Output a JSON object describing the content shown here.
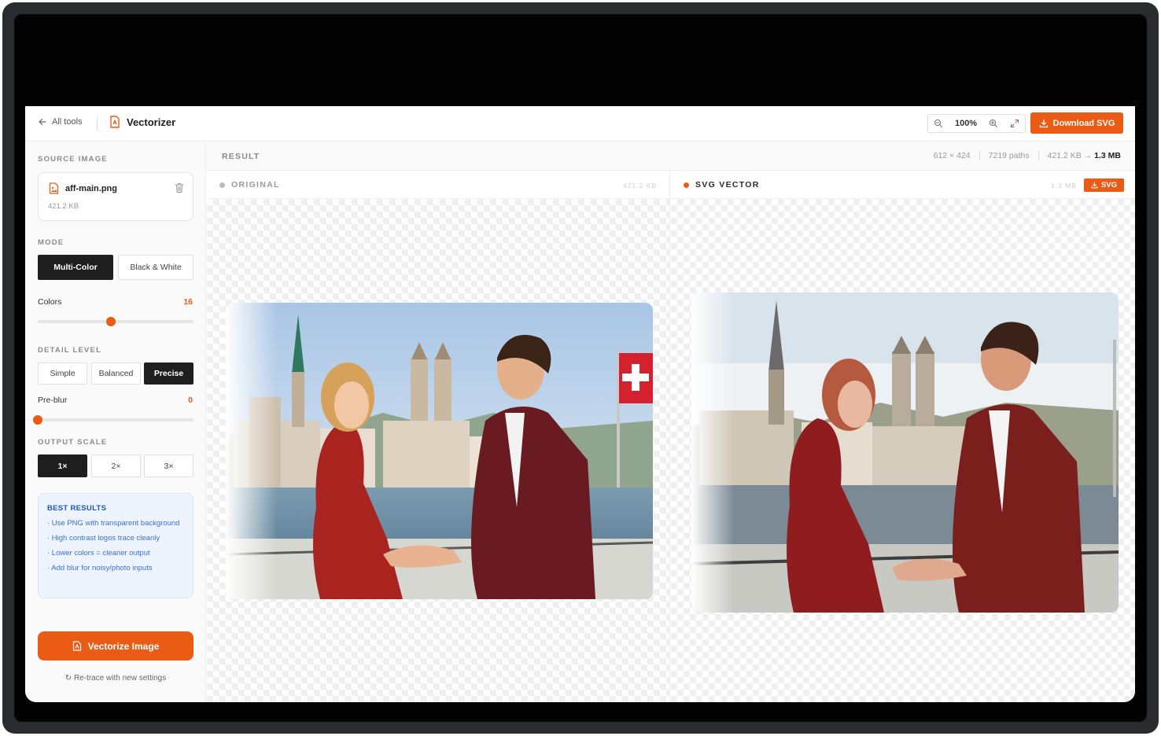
{
  "topbar": {
    "back_label": "All tools",
    "app_title": "Vectorizer",
    "zoom_level": "100%",
    "download_label": "Download SVG"
  },
  "sidebar": {
    "source_label": "SOURCE IMAGE",
    "file": {
      "name": "aff-main.png",
      "size": "421.2 KB"
    },
    "mode_label": "MODE",
    "modes": [
      "Multi-Color",
      "Black & White"
    ],
    "colors": {
      "label": "Colors",
      "value": "16",
      "fraction": 0.47
    },
    "detail_label": "DETAIL LEVEL",
    "details": [
      "Simple",
      "Balanced",
      "Precise"
    ],
    "preblur": {
      "label": "Pre-blur",
      "value": "0",
      "fraction": 0.0
    },
    "scale_label": "OUTPUT SCALE",
    "scales": [
      "1×",
      "2×",
      "3×"
    ],
    "tips": {
      "title": "BEST RESULTS",
      "items": [
        "· Use PNG with transparent background",
        "· High contrast logos trace cleanly",
        "· Lower colors = cleaner output",
        "· Add blur for noisy/photo inputs"
      ]
    },
    "vectorize_label": "Vectorize Image",
    "retrace_label": "Re-trace with new settings"
  },
  "main": {
    "result_label": "RESULT",
    "stats": {
      "dimensions": "612 × 424",
      "paths": "7219 paths",
      "size_before": "421.2 KB",
      "arrow": "→",
      "size_after": "1.3 MB"
    },
    "original": {
      "title": "ORIGINAL",
      "size": "421.2 KB"
    },
    "vector": {
      "title": "SVG VECTOR",
      "size": "1.3 MB",
      "tag": "SVG"
    }
  },
  "colors": {
    "accent": "#ea5b16",
    "dark": "#1e1e1e",
    "tip_bg": "#eef4fd",
    "tip_text": "#3b6fd1"
  }
}
